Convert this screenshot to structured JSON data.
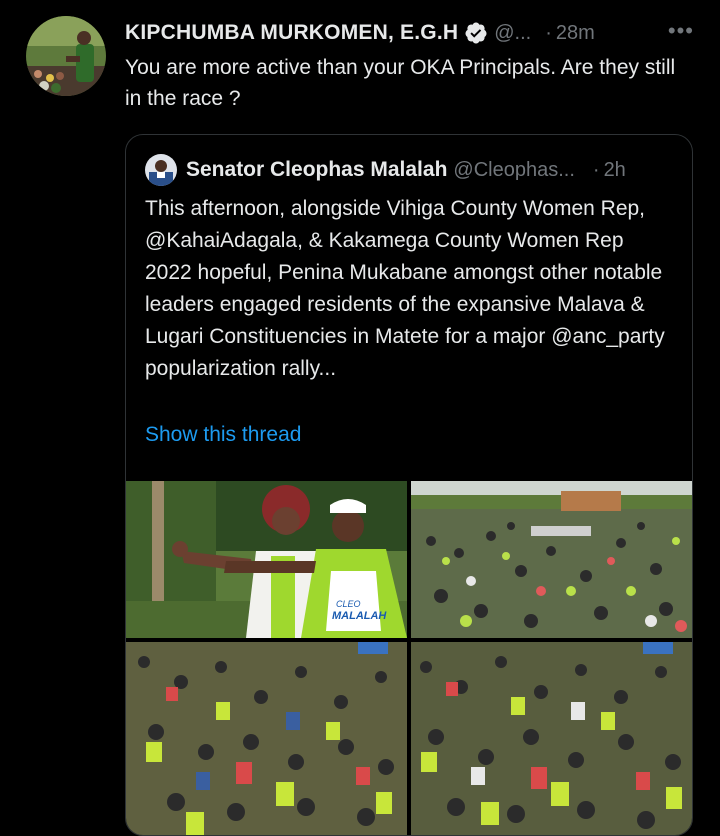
{
  "tweet": {
    "author_name": "KIPCHUMBA MURKOMEN, E.G.H",
    "author_handle": "@...",
    "separator": "·",
    "time": "28m",
    "more_label": "•••",
    "text": "You are more active than your OKA Principals. Are they still in the race ?"
  },
  "quoted": {
    "author_name": "Senator Cleophas Malalah",
    "author_handle": "@Cleophas...",
    "separator": "·",
    "time": "2h",
    "text": "This afternoon, alongside Vihiga County Women Rep, @KahaiAdagala, & Kakamega County Women Rep 2022 hopeful, Penina Mukabane amongst  other notable leaders engaged residents of the expansive Malava & Lugari Constituencies in Matete for a major @anc_party popularization rally...",
    "show_thread": "Show this thread",
    "shirt_text_line1": "CLEO",
    "shirt_text_line2": "MALALAH"
  },
  "colors": {
    "background": "#000000",
    "text": "#e7e9ea",
    "muted": "#71767b",
    "link": "#1d9bf0",
    "border": "#2f3336",
    "verified_badge": "#e7e9ea"
  },
  "icons": [
    "verified-badge-icon",
    "more-options-icon"
  ]
}
